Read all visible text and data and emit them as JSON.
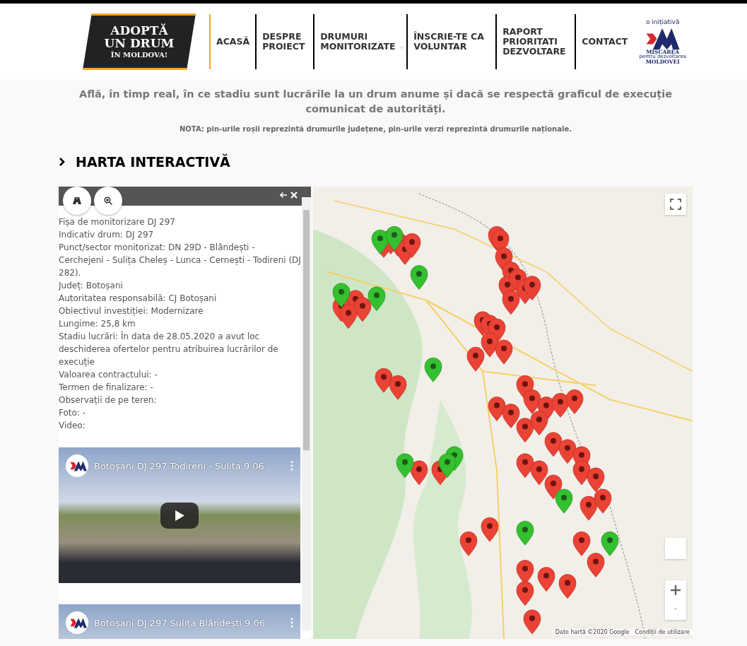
{
  "logo": {
    "line_1": "ADOPTĂ",
    "line_2": "UN DRUM",
    "line_3": "ÎN MOLDOVA!"
  },
  "nav": [
    {
      "label": "ACASĂ",
      "selected": true,
      "dropdown": false
    },
    {
      "label": "DESPRE PROIECT",
      "selected": false,
      "dropdown": false
    },
    {
      "label": "DRUMURI MONITORIZATE",
      "selected": false,
      "dropdown": true
    },
    {
      "label": "ÎNSCRIE-TE CA VOLUNTAR",
      "selected": false,
      "dropdown": false
    },
    {
      "label": "RAPORT PRIORITATI DEZVOLTARE",
      "selected": false,
      "dropdown": false
    },
    {
      "label": "CONTACT",
      "selected": false,
      "dropdown": false
    }
  ],
  "partner": {
    "tagline": "o inițiativă",
    "name": "MIȘCAREA",
    "sub": "pentru dezvoltarea",
    "name_2": "MOLDOVEI"
  },
  "intro": "Află, în timp real, în ce stadiu sunt lucrările la un drum anume și dacă se respectă graficul de execuție comunicat de autorități.",
  "note": "NOTA: pin-urile roșii reprezintă drumurile județene, pin-urile verzi reprezintă drumurile naționale.",
  "section_title": "HARTA INTERACTIVĂ",
  "panel": {
    "lines": [
      "Fișa de monitorizare DJ 297",
      "Indicativ drum: DJ 297",
      "Punct/sector monitorizat: DN 29D - Blândești - Cerchejeni - Sulița Cheleș - Lunca - Cernești - Todireni (DJ 282).",
      "Județ: Botoșani",
      "Autoritatea responsabilă: CJ Botoșani",
      "Obiectivul investiției: Modernizare",
      "Lungime: 25,8 km",
      "Stadiu lucrări: În data de 28.05.2020 a avut loc deschiderea ofertelor pentru atribuirea lucrărilor de execuție",
      "Valoarea contractului: -",
      "Termen de finalizare: -",
      "Observații de pe teren:",
      "Foto: -",
      "Video:"
    ],
    "videos": [
      {
        "title": "Botoșani DJ 297 Todireni - Sulita 9 06"
      },
      {
        "title": "Botoșani DJ 297 Sulița Blândești 9.06"
      }
    ]
  },
  "map": {
    "attribution": "Date hartă ©2020 Google",
    "terms": "Condiții de utilizare"
  }
}
